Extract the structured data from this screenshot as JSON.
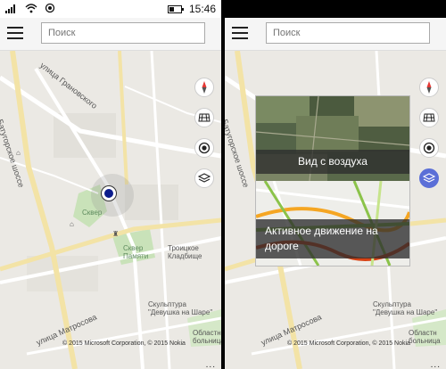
{
  "status_bar": {
    "time": "15:46",
    "battery_level": 0.4,
    "icons": [
      "signal-icon",
      "wifi-icon",
      "location-service-icon"
    ]
  },
  "search": {
    "placeholder": "Поиск"
  },
  "map": {
    "labels": {
      "street_granovskogo": "улица Грановского",
      "highway": "Батугорское шоссе",
      "square": "Сквер",
      "square_memory": "Сквер\nПамяти",
      "cemetery": "Троицкое\nКладбище",
      "street_matrosova": "улица Матросова",
      "sculpture": "Скульптура\n\"Девушка на Шаре\"",
      "region": "Областн\nбольница"
    },
    "copyright": "© 2015 Microsoft Corporation, © 2015 Nokia",
    "more": "..."
  },
  "controls": [
    "compass-icon",
    "aerial-mode-icon",
    "locate-me-icon",
    "layers-icon"
  ],
  "layers_panel": {
    "aerial_label": "Вид с воздуха",
    "traffic_label": "Активное движение на дороге"
  },
  "colors": {
    "location_dot": "#0b1c8c",
    "active_control": "#5b6fd7",
    "road": "#f3e3a6",
    "park": "#c9e2b9"
  }
}
